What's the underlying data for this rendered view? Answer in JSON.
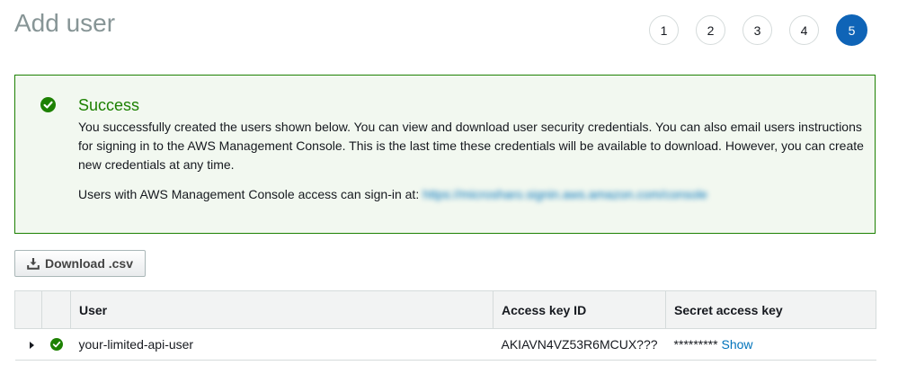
{
  "page": {
    "title": "Add user"
  },
  "steps": [
    "1",
    "2",
    "3",
    "4",
    "5"
  ],
  "active_step": "5",
  "success": {
    "title": "Success",
    "body": "You successfully created the users shown below. You can view and download user security credentials. You can also email users instructions for signing in to the AWS Management Console. This is the last time these credentials will be available to download. However, you can create new credentials at any time.",
    "signin_label": "Users with AWS Management Console access can sign-in at:",
    "signin_url": "https://microsharo.signin.aws.amazon.com/console"
  },
  "download_button": {
    "label": "Download .csv",
    "icon": "download-icon"
  },
  "table": {
    "headers": {
      "user": "User",
      "access_key": "Access key ID",
      "secret": "Secret access key"
    },
    "rows": [
      {
        "user": "your-limited-api-user",
        "access_key": "AKIAVN4VZ53R6MCUX???",
        "secret_masked": "*********",
        "show_label": "Show"
      }
    ]
  },
  "colors": {
    "accent": "#0f64b7",
    "success": "#1d8102",
    "link": "#0073bb"
  }
}
